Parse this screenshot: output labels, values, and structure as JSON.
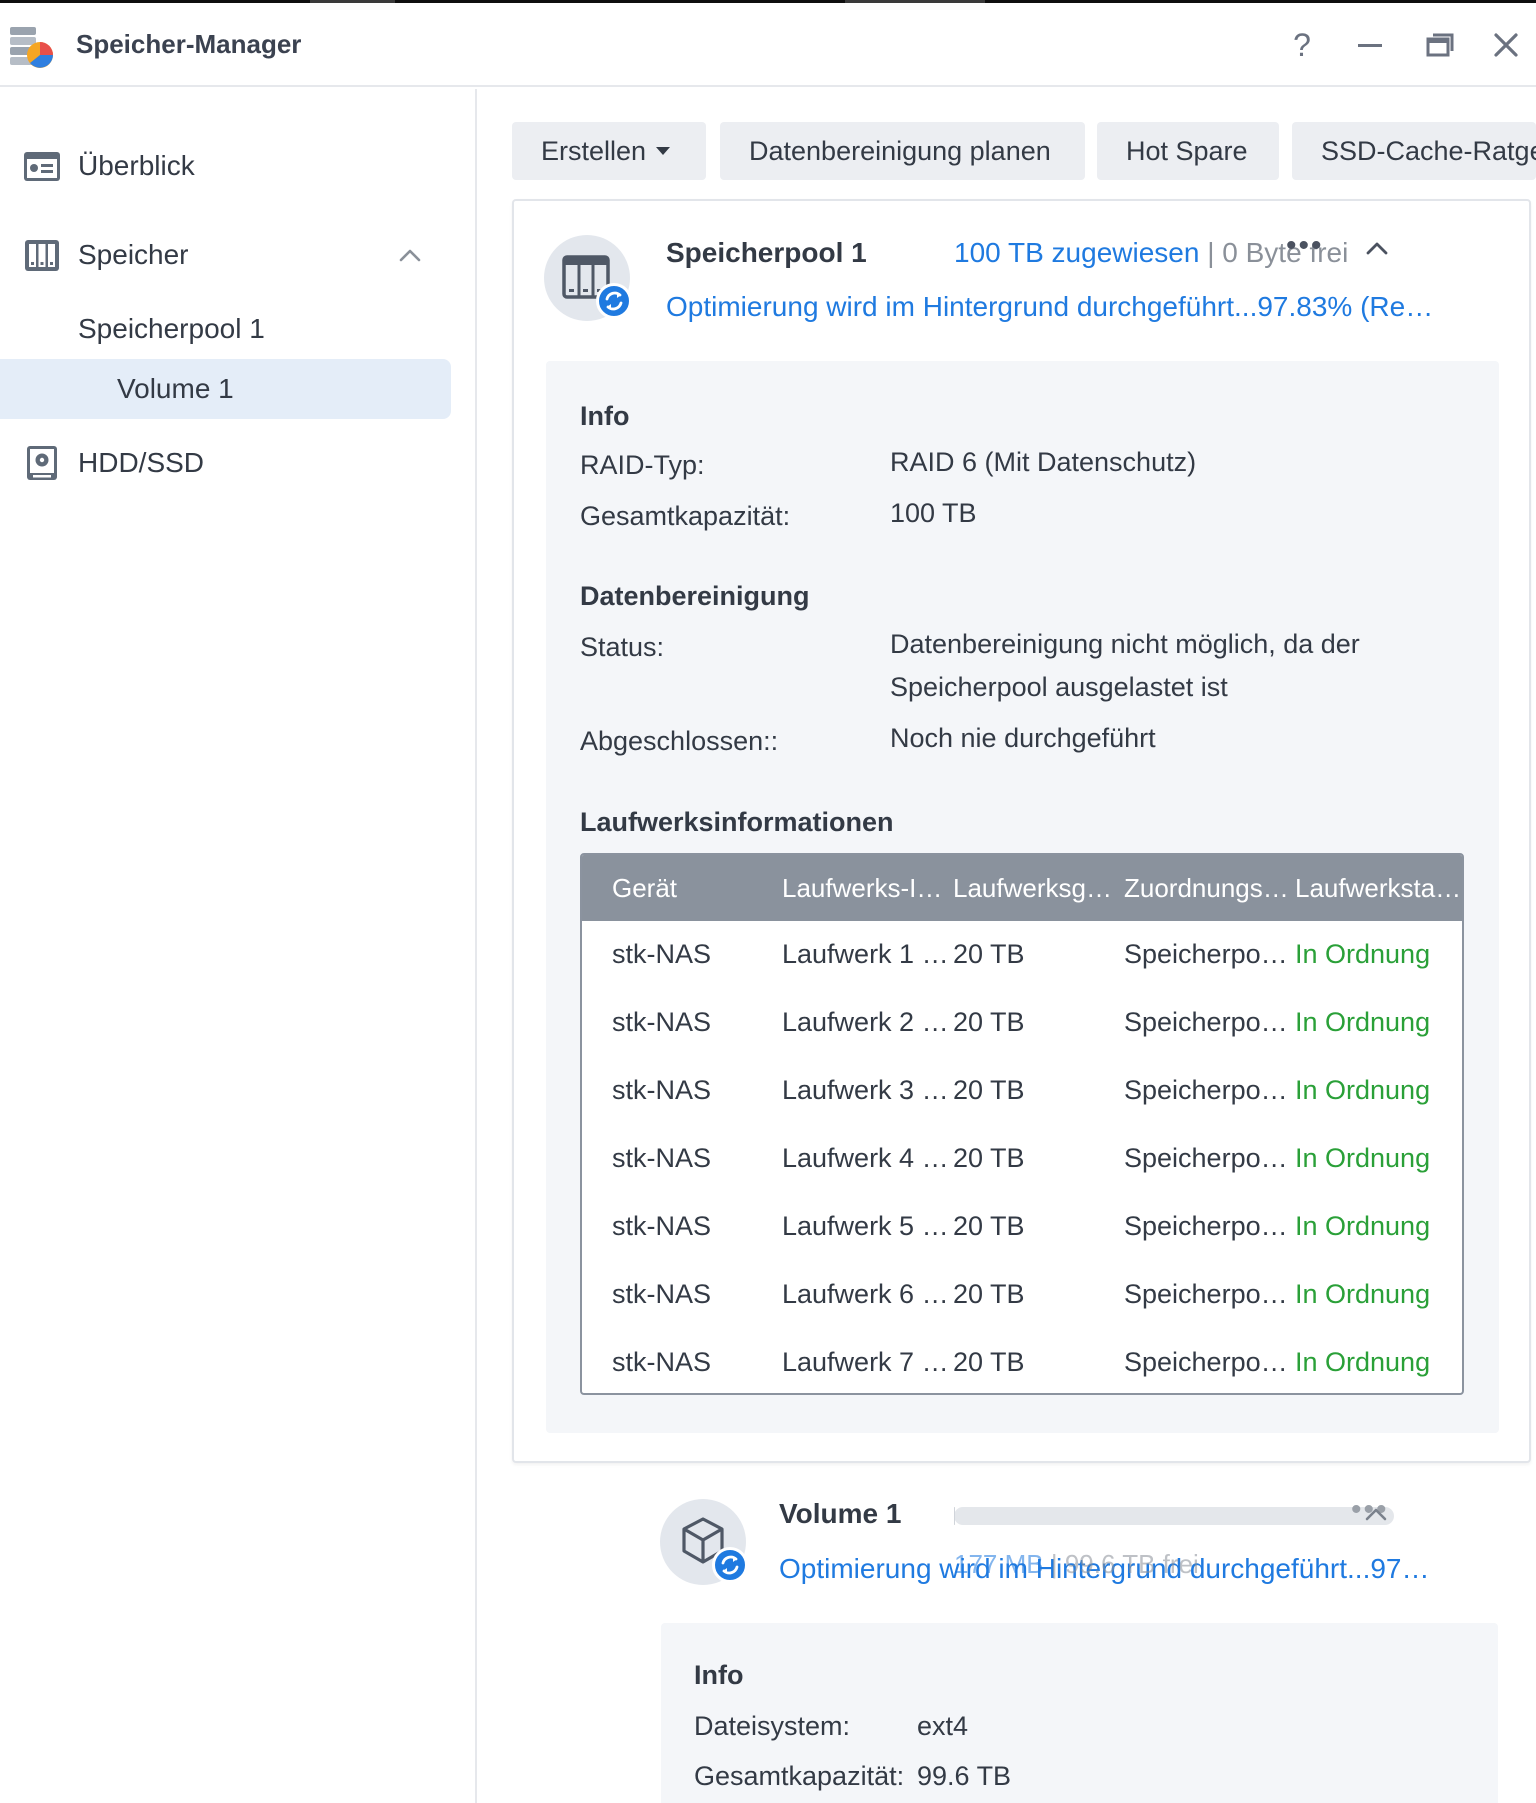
{
  "window": {
    "title": "Speicher-Manager",
    "help": "?",
    "minimize": "—",
    "close": "✕"
  },
  "sidebar": {
    "items": [
      {
        "label": "Überblick",
        "icon": "overview-icon"
      },
      {
        "label": "Speicher",
        "icon": "storage-icon",
        "expanded": true
      },
      {
        "label": "Speicherpool 1"
      },
      {
        "label": "Volume 1",
        "selected": true
      },
      {
        "label": "HDD/SSD",
        "icon": "hdd-icon"
      }
    ]
  },
  "toolbar": {
    "create": "Erstellen",
    "scrub": "Datenbereinigung planen",
    "hotspare": "Hot Spare",
    "ssd_cache": "SSD-Cache-Ratgeber"
  },
  "pool": {
    "title": "Speicherpool 1",
    "allocated": "100 TB zugewiesen",
    "separator": "|",
    "free": "0 Byte frei",
    "more": "•••",
    "status": "Optimierung wird im Hintergrund durchgeführt...97.83% (Re…",
    "info": {
      "heading": "Info",
      "raid_key": "RAID-Typ:",
      "raid_val": "RAID 6 (Mit Datenschutz)",
      "cap_key": "Gesamtkapazität:",
      "cap_val": "100 TB"
    },
    "scrubbing": {
      "heading": "Datenbereinigung",
      "status_key": "Status:",
      "status_val_1": "Datenbereinigung nicht möglich, da der",
      "status_val_2": "Speicherpool ausgelastet ist",
      "done_key": "Abgeschlossen::",
      "done_val": "Noch nie durchgeführt"
    },
    "drives": {
      "heading": "Laufwerksinformationen",
      "columns": [
        "Gerät",
        "Laufwerks-I…",
        "Laufwerksg…",
        "Zuordnungs…",
        "Laufwerksta…"
      ],
      "rows": [
        [
          "stk-NAS",
          "Laufwerk 1 …",
          "20 TB",
          "Speicherpo…",
          "In Ordnung"
        ],
        [
          "stk-NAS",
          "Laufwerk 2 …",
          "20 TB",
          "Speicherpo…",
          "In Ordnung"
        ],
        [
          "stk-NAS",
          "Laufwerk 3 …",
          "20 TB",
          "Speicherpo…",
          "In Ordnung"
        ],
        [
          "stk-NAS",
          "Laufwerk 4 …",
          "20 TB",
          "Speicherpo…",
          "In Ordnung"
        ],
        [
          "stk-NAS",
          "Laufwerk 5 …",
          "20 TB",
          "Speicherpo…",
          "In Ordnung"
        ],
        [
          "stk-NAS",
          "Laufwerk 6 …",
          "20 TB",
          "Speicherpo…",
          "In Ordnung"
        ],
        [
          "stk-NAS",
          "Laufwerk 7 …",
          "20 TB",
          "Speicherpo…",
          "In Ordnung"
        ]
      ]
    }
  },
  "volume": {
    "title": "Volume 1",
    "more": "•••",
    "used": "177 MB",
    "separator": "|",
    "free": "99.6 TB frei",
    "usage_fraction": 0.002,
    "status": "Optimierung wird im Hintergrund durchgeführt...97…",
    "info": {
      "heading": "Info",
      "fs_key": "Dateisystem:",
      "fs_val": "ext4",
      "cap_key": "Gesamtkapazität:",
      "cap_val": "99.6 TB"
    }
  },
  "colors": {
    "accent": "#1f7ae0",
    "ok": "#2aa038",
    "selected_bg": "#e4edf8",
    "table_header": "#8a929d"
  }
}
